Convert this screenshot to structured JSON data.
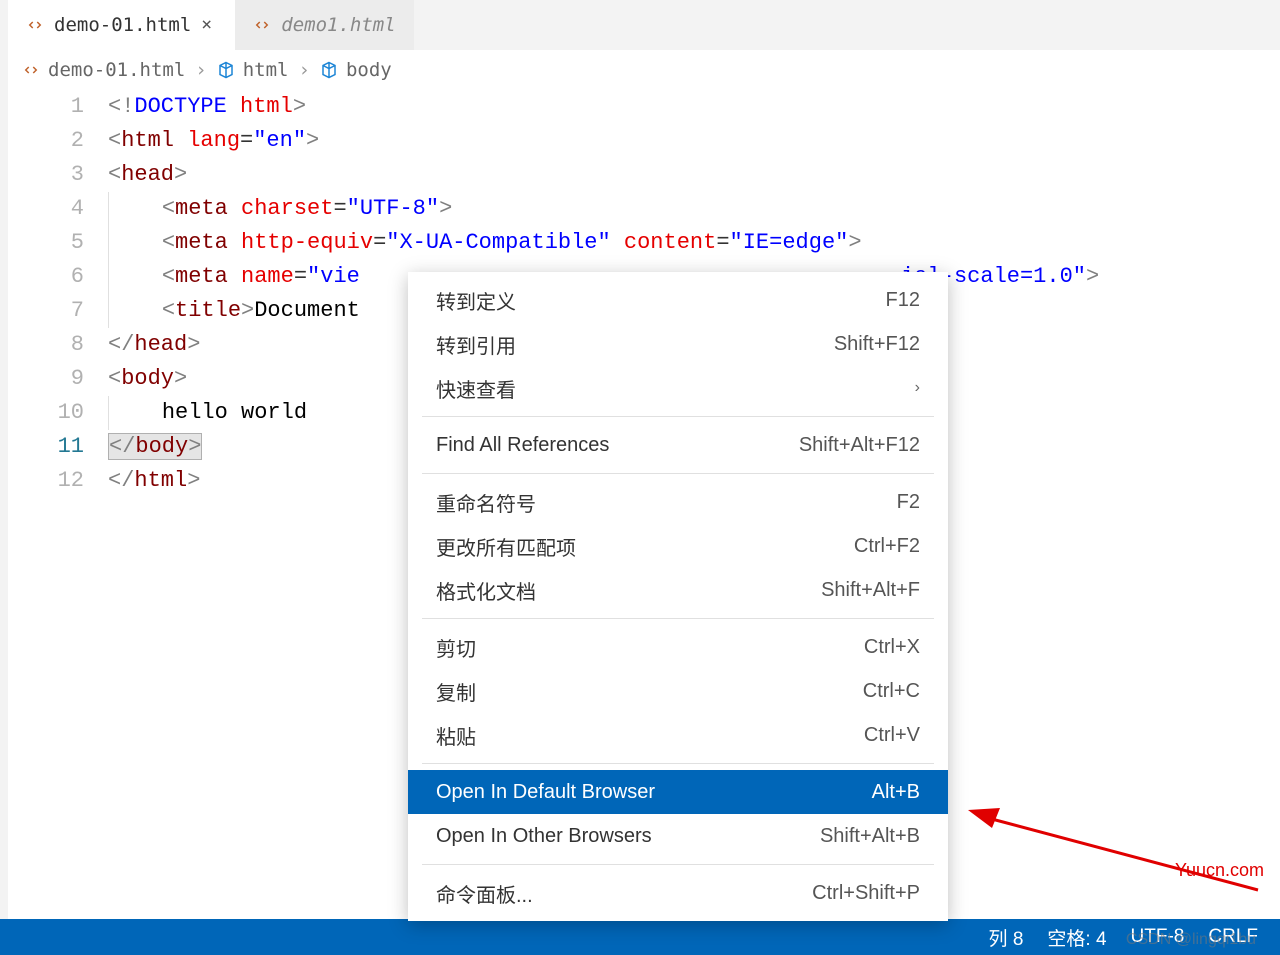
{
  "tabs": [
    {
      "label": "demo-01.html",
      "active": true
    },
    {
      "label": "demo1.html",
      "active": false
    }
  ],
  "breadcrumb": {
    "file": "demo-01.html",
    "sym1": "html",
    "sym2": "body"
  },
  "code": {
    "lines": [
      1,
      2,
      3,
      4,
      5,
      6,
      7,
      8,
      9,
      10,
      11,
      12
    ],
    "active_line": 11,
    "content": [
      {
        "n": 1,
        "html": "<span class='tok-gray'>&lt;!</span><span class='tok-doctype'>DOCTYPE</span> <span class='tok-attr'>html</span><span class='tok-gray'>&gt;</span>"
      },
      {
        "n": 2,
        "html": "<span class='tok-gray'>&lt;</span><span class='tok-tag'>html</span> <span class='tok-attr'>lang</span>=<span class='tok-str'>\"en\"</span><span class='tok-gray'>&gt;</span>"
      },
      {
        "n": 3,
        "html": "<span class='tok-gray'>&lt;</span><span class='tok-tag'>head</span><span class='tok-gray'>&gt;</span>"
      },
      {
        "n": 4,
        "html": "<span class='indent-guide'>&nbsp;</span>   <span class='tok-gray'>&lt;</span><span class='tok-tag'>meta</span> <span class='tok-attr'>charset</span>=<span class='tok-str'>\"UTF-8\"</span><span class='tok-gray'>&gt;</span>"
      },
      {
        "n": 5,
        "html": "<span class='indent-guide'>&nbsp;</span>   <span class='tok-gray'>&lt;</span><span class='tok-tag'>meta</span> <span class='tok-attr'>http-equiv</span>=<span class='tok-str'>\"X-UA-Compatible\"</span> <span class='tok-attr'>content</span>=<span class='tok-str'>\"IE=edge\"</span><span class='tok-gray'>&gt;</span>"
      },
      {
        "n": 6,
        "html": "<span class='indent-guide'>&nbsp;</span>   <span class='tok-gray'>&lt;</span><span class='tok-tag'>meta</span> <span class='tok-attr'>name</span>=<span class='tok-str'>\"vie</span>                                         <span class='tok-str'>ial-scale=1.0\"</span><span class='tok-gray'>&gt;</span>"
      },
      {
        "n": 7,
        "html": "<span class='indent-guide'>&nbsp;</span>   <span class='tok-gray'>&lt;</span><span class='tok-tag'>title</span><span class='tok-gray'>&gt;</span><span class='tok-text'>Document</span>"
      },
      {
        "n": 8,
        "html": "<span class='tok-gray'>&lt;/</span><span class='tok-tag'>head</span><span class='tok-gray'>&gt;</span>"
      },
      {
        "n": 9,
        "html": "<span class='tok-gray'>&lt;</span><span class='tok-tag'>body</span><span class='tok-gray'>&gt;</span>"
      },
      {
        "n": 10,
        "html": "<span class='indent-guide'>&nbsp;</span>   <span class='tok-text'>hello world</span>"
      },
      {
        "n": 11,
        "html": "<span class='sel'><span class='tok-gray'>&lt;/</span><span class='tok-tag'>body</span><span class='tok-gray'>&gt;</span></span>"
      },
      {
        "n": 12,
        "html": "<span class='tok-gray'>&lt;/</span><span class='tok-tag'>html</span><span class='tok-gray'>&gt;</span>"
      }
    ]
  },
  "context_menu": [
    {
      "type": "item",
      "label": "转到定义",
      "kbd": "F12"
    },
    {
      "type": "item",
      "label": "转到引用",
      "kbd": "Shift+F12"
    },
    {
      "type": "item",
      "label": "快速查看",
      "kbd": "›",
      "submenu": true
    },
    {
      "type": "sep"
    },
    {
      "type": "item",
      "label": "Find All References",
      "kbd": "Shift+Alt+F12"
    },
    {
      "type": "sep"
    },
    {
      "type": "item",
      "label": "重命名符号",
      "kbd": "F2"
    },
    {
      "type": "item",
      "label": "更改所有匹配项",
      "kbd": "Ctrl+F2"
    },
    {
      "type": "item",
      "label": "格式化文档",
      "kbd": "Shift+Alt+F"
    },
    {
      "type": "sep"
    },
    {
      "type": "item",
      "label": "剪切",
      "kbd": "Ctrl+X"
    },
    {
      "type": "item",
      "label": "复制",
      "kbd": "Ctrl+C"
    },
    {
      "type": "item",
      "label": "粘贴",
      "kbd": "Ctrl+V"
    },
    {
      "type": "sep"
    },
    {
      "type": "item",
      "label": "Open In Default Browser",
      "kbd": "Alt+B",
      "selected": true
    },
    {
      "type": "item",
      "label": "Open In Other Browsers",
      "kbd": "Shift+Alt+B"
    },
    {
      "type": "sep"
    },
    {
      "type": "item",
      "label": "命令面板...",
      "kbd": "Ctrl+Shift+P"
    }
  ],
  "status": {
    "col_label": "列",
    "col_val": "8",
    "spaces_label": "空格:",
    "spaces_val": "4",
    "encoding": "UTF-8",
    "eol": "CRLF"
  },
  "watermark": "CSDN @lingqi1bu",
  "site_mark": "Yuucn.com"
}
